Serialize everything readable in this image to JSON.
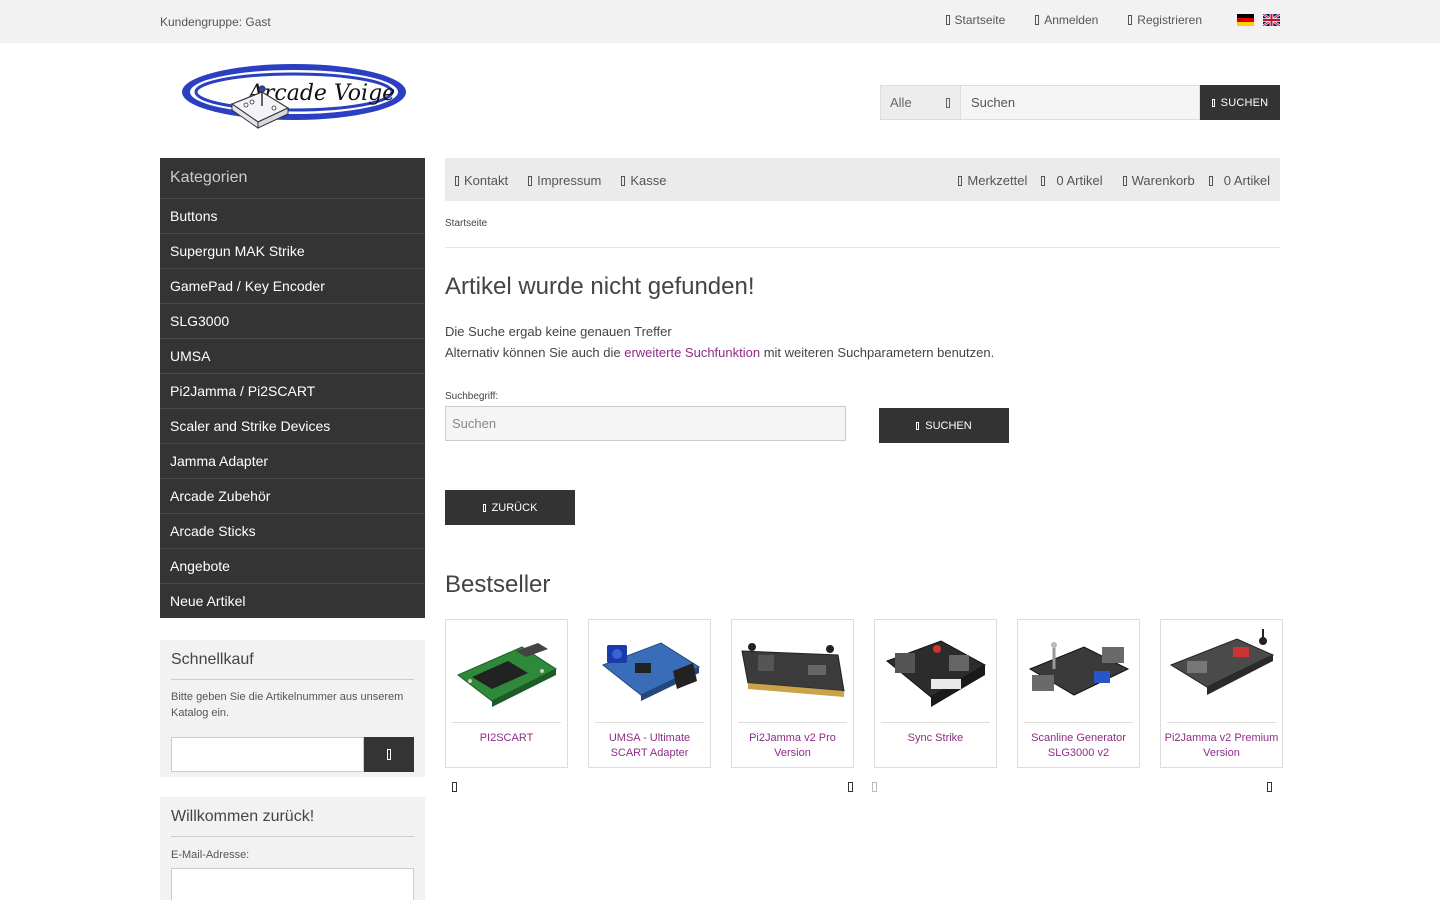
{
  "topbar": {
    "customer_group": "Kundengruppe: Gast",
    "links": [
      "Startseite",
      "Anmelden",
      "Registrieren"
    ]
  },
  "search": {
    "category": "Alle",
    "placeholder": "Suchen",
    "button": "SUCHEN"
  },
  "sidebar": {
    "title": "Kategorien",
    "items": [
      "Buttons",
      "Supergun MAK Strike",
      "GamePad / Key Encoder",
      "SLG3000",
      "UMSA",
      "Pi2Jamma / Pi2SCART",
      "Scaler and Strike Devices",
      "Jamma Adapter",
      "Arcade Zubehör",
      "Arcade Sticks",
      "Angebote",
      "Neue Artikel"
    ],
    "quickbuy": {
      "title": "Schnellkauf",
      "text": "Bitte geben Sie die Artikelnummer aus unserem Katalog ein."
    },
    "login": {
      "title": "Willkommen zurück!",
      "email_label": "E-Mail-Adresse:"
    }
  },
  "mainnav": {
    "left": [
      "Kontakt",
      "Impressum",
      "Kasse"
    ],
    "wishlist": "Merkzettel",
    "wishlist_count": "0 Artikel",
    "cart": "Warenkorb",
    "cart_count": "0 Artikel"
  },
  "breadcrumb": "Startseite",
  "main": {
    "heading": "Artikel wurde nicht gefunden!",
    "line1": "Die Suche ergab keine genauen Treffer",
    "line2_pre": "Alternativ können Sie auch die ",
    "line2_link": "erweiterte Suchfunktion",
    "line2_post": " mit weiteren Suchparametern benutzen.",
    "search_label": "Suchbegriff:",
    "search_placeholder": "Suchen",
    "search_button": "SUCHEN",
    "back_button": "ZURÜCK"
  },
  "bestseller": {
    "title": "Bestseller",
    "products": [
      "PI2SCART",
      "UMSA - Ultimate SCART Adapter",
      "Pi2Jamma v2 Pro Version",
      "Sync Strike",
      "Scanline Generator SLG3000 v2",
      "Pi2Jamma v2 Premium Version"
    ]
  },
  "colors": {
    "dark": "#333333",
    "link": "#8e2d86",
    "topbar_bg": "#f2f2f2"
  }
}
